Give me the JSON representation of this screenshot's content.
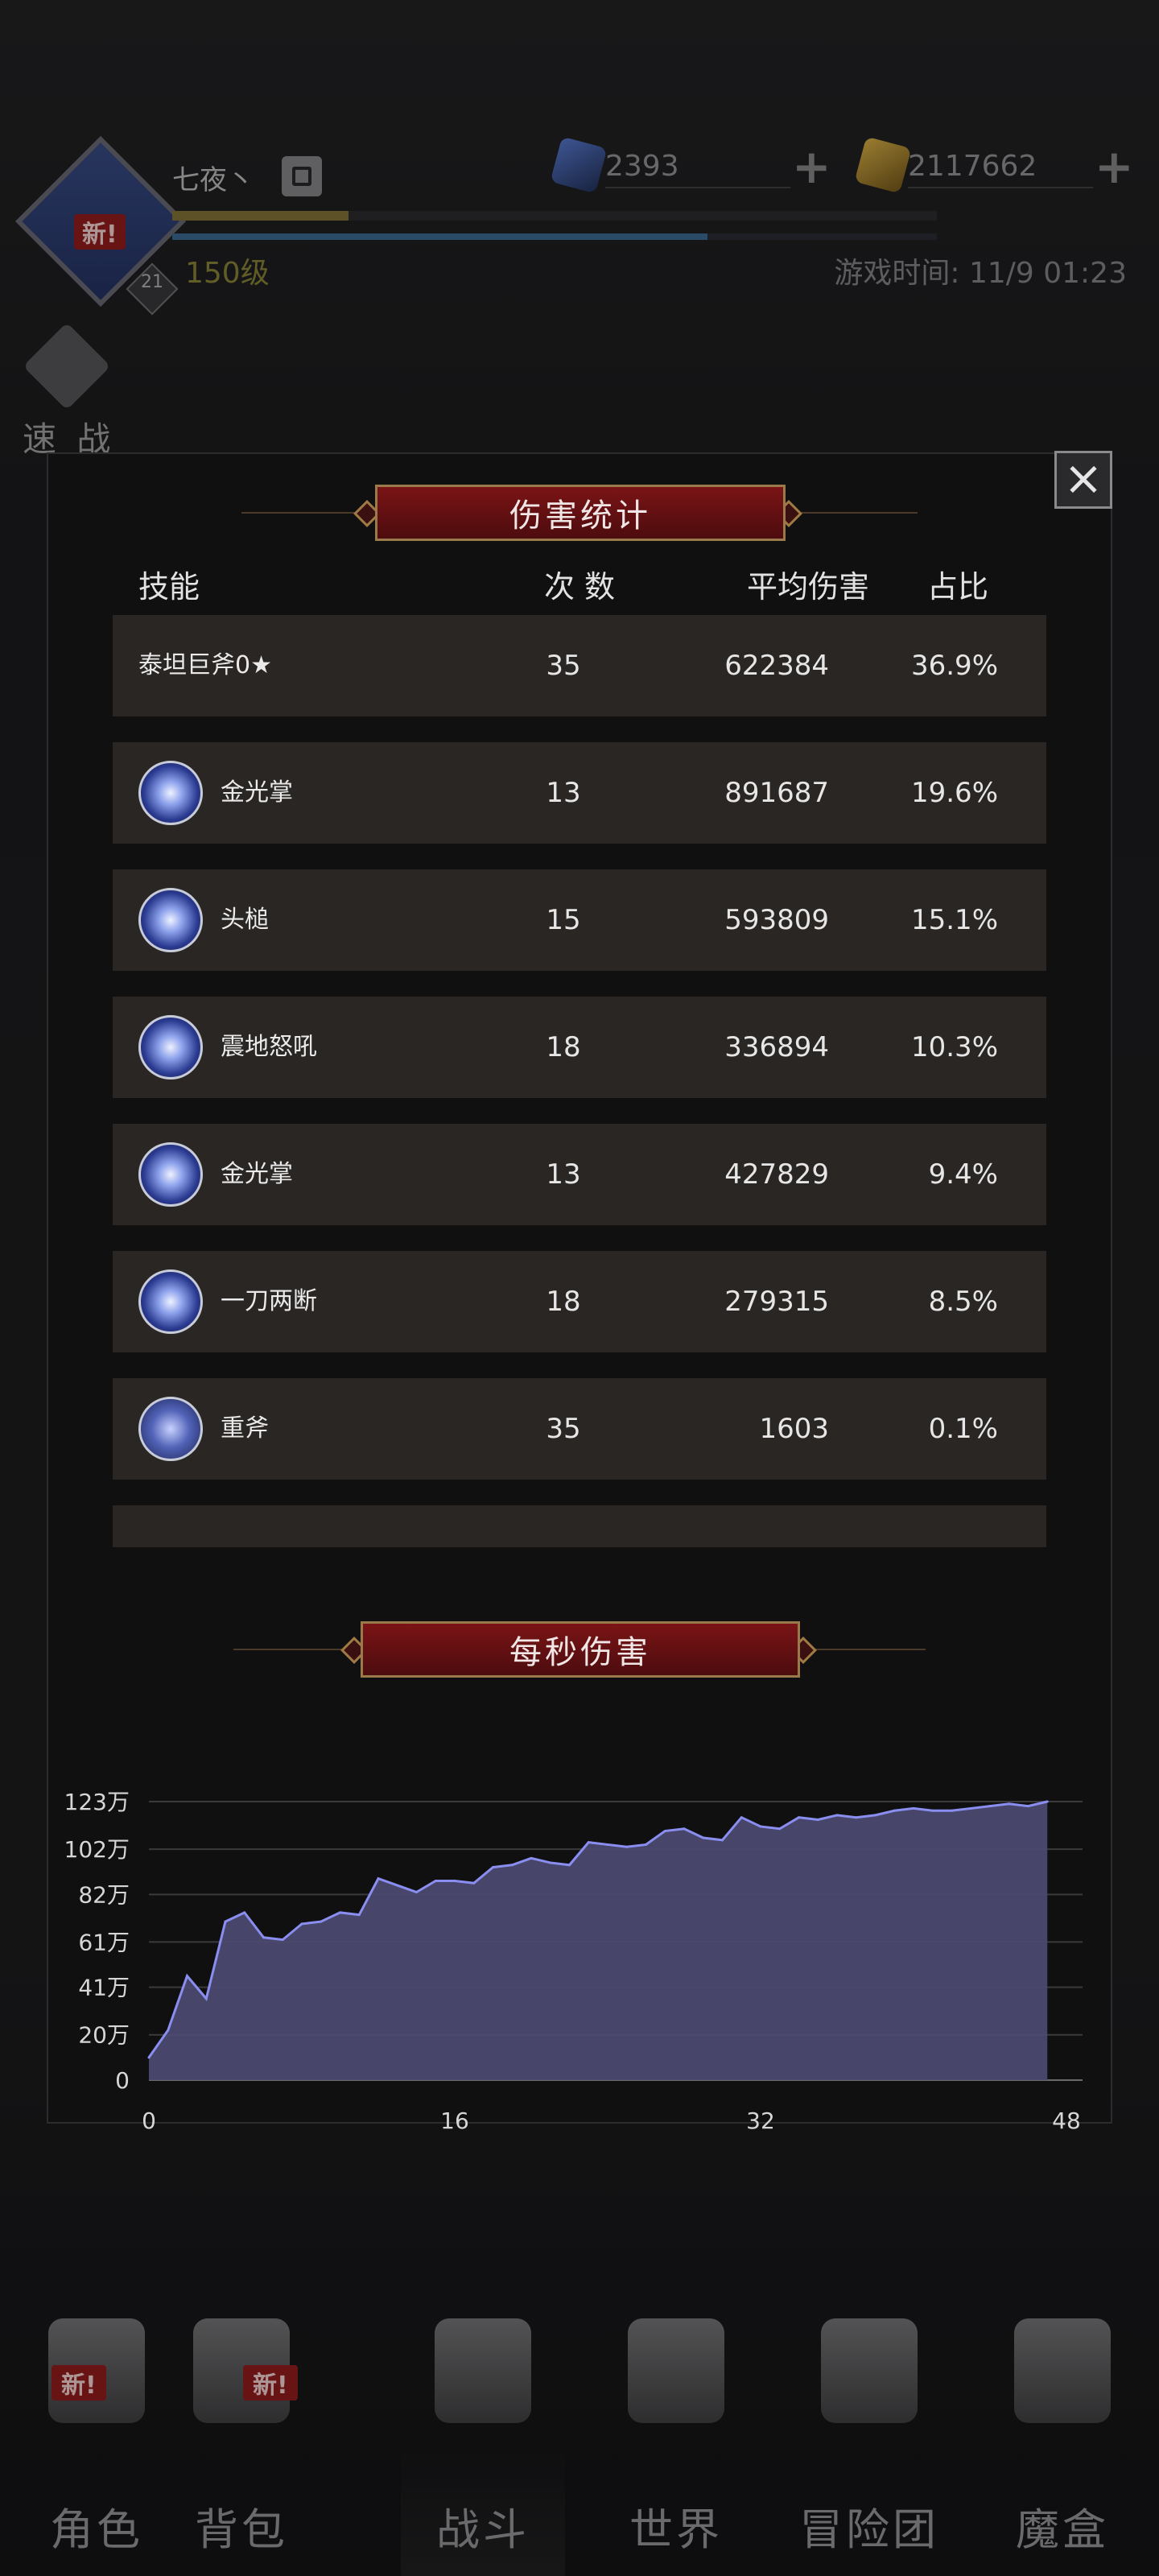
{
  "player": {
    "name": "七夜丶",
    "level": "150级",
    "new_badge": "新!",
    "rank_num": "21",
    "xp_fraction": 0.23,
    "hp_fraction": 0.7
  },
  "currency": {
    "gems": "2393",
    "gold": "2117662"
  },
  "game_time": "游戏时间: 11/9 01:23",
  "quick_battle": "速 战",
  "damage_stats": {
    "title": "伤害统计",
    "headers": {
      "skill": "技能",
      "count": "次 数",
      "avg": "平均伤害",
      "pct": "占比"
    },
    "rows": [
      {
        "name": "泰坦巨斧0★",
        "icon": "",
        "count": "35",
        "avg": "622384",
        "pct": "36.9%"
      },
      {
        "name": "金光掌",
        "icon": "burst-skill-icon",
        "count": "13",
        "avg": "891687",
        "pct": "19.6%"
      },
      {
        "name": "头槌",
        "icon": "claw-skill-icon",
        "count": "15",
        "avg": "593809",
        "pct": "15.1%"
      },
      {
        "name": "震地怒吼",
        "icon": "roar-skill-icon",
        "count": "18",
        "avg": "336894",
        "pct": "10.3%"
      },
      {
        "name": "金光掌",
        "icon": "burst-skill-icon",
        "count": "13",
        "avg": "427829",
        "pct": "9.4%"
      },
      {
        "name": "一刀两断",
        "icon": "slash-skill-icon",
        "count": "18",
        "avg": "279315",
        "pct": "8.5%"
      },
      {
        "name": "重斧",
        "icon": "sword-skill-icon",
        "count": "35",
        "avg": "1603",
        "pct": "0.1%"
      }
    ]
  },
  "dps": {
    "title": "每秒伤害"
  },
  "chart_data": {
    "type": "area",
    "title": "每秒伤害",
    "xlabel": "",
    "ylabel": "",
    "xlim": [
      0,
      48
    ],
    "ylim": [
      0,
      123
    ],
    "xticks": [
      "0",
      "16",
      "32",
      "48"
    ],
    "yticks": [
      "123万",
      "102万",
      "82万",
      "61万",
      "41万",
      "20万",
      "0"
    ],
    "ytick_values": [
      123,
      102,
      82,
      61,
      41,
      20,
      0
    ],
    "grid": true,
    "color": "#8a8ef0",
    "x": [
      0,
      1,
      2,
      3,
      4,
      5,
      6,
      7,
      8,
      9,
      10,
      11,
      12,
      13,
      14,
      15,
      16,
      17,
      18,
      19,
      20,
      21,
      22,
      23,
      24,
      25,
      26,
      27,
      28,
      29,
      30,
      31,
      32,
      33,
      34,
      35,
      36,
      37,
      38,
      39,
      40,
      41,
      42,
      43,
      44,
      45,
      46,
      47
    ],
    "y": [
      10,
      22,
      46,
      36,
      70,
      74,
      63,
      62,
      69,
      70,
      74,
      73,
      89,
      86,
      83,
      88,
      88,
      87,
      94,
      95,
      98,
      96,
      95,
      105,
      104,
      103,
      104,
      110,
      111,
      107,
      106,
      116,
      112,
      111,
      116,
      115,
      117,
      116,
      117,
      119,
      120,
      119,
      119,
      120,
      121,
      122,
      121,
      123
    ]
  },
  "nav": {
    "items": [
      "角色",
      "背包",
      "战斗",
      "世界",
      "冒险团",
      "魔盒"
    ],
    "new_badge": "新!"
  }
}
